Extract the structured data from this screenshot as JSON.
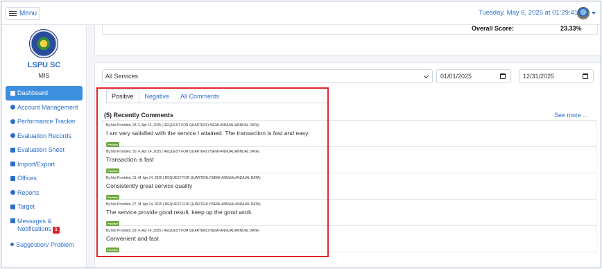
{
  "topbar": {
    "menu_label": "Menu",
    "datetime": "Tuesday, May 6, 2025 at 01:29:41 PM"
  },
  "sidebar": {
    "org_name": "LSPU SC",
    "org_sub": "MIS",
    "items": [
      {
        "label": "Dashboard",
        "icon": "dashboard-icon",
        "active": true
      },
      {
        "label": "Account Management",
        "icon": "users-icon"
      },
      {
        "label": "Performance Tracker",
        "icon": "gauge-icon"
      },
      {
        "label": "Evaluation Records",
        "icon": "gauge-icon"
      },
      {
        "label": "Evaluation Sheet",
        "icon": "document-icon"
      },
      {
        "label": "Import/Export",
        "icon": "file-icon"
      },
      {
        "label": "Offices",
        "icon": "building-icon"
      },
      {
        "label": "Reports",
        "icon": "gauge-icon"
      },
      {
        "label": "Target",
        "icon": "target-icon"
      },
      {
        "label": "Messages & Notifications",
        "icon": "envelope-icon",
        "badge": "1"
      },
      {
        "label": "Suggestion/ Problem",
        "icon": "lightbulb-icon"
      }
    ],
    "messages_line1": "Messages &",
    "messages_line2": "Notifications",
    "messages_badge": "1"
  },
  "score": {
    "label": "Overall Score:",
    "value": "23.33%"
  },
  "filters": {
    "service": "All Services",
    "date_from": "01/01/2025",
    "date_to": "12/31/2025"
  },
  "tabs": [
    {
      "label": "Positive",
      "active": true
    },
    {
      "label": "Negative"
    },
    {
      "label": "All Comments"
    }
  ],
  "comments": {
    "title": "(5) Recently Comments",
    "see_more": "See more ...",
    "items": [
      {
        "meta": "By:Not Provided, 28, F, Apr 14, 2025 | REQUEST FOR QUARTERLY/SEMI-ANNUAL/ANNUAL DATA)",
        "text": "I am very satisfied with the service I attained. The transaction is fast and easy.",
        "badge": "Positive"
      },
      {
        "meta": "By:Not Provided, 50, F, Apr 14, 2025 | REQUEST FOR QUARTERLY/SEMI-ANNUAL/ANNUAL DATA)",
        "text": "Transaction is fast",
        "badge": "Positive"
      },
      {
        "meta": "By:Not Provided, 31, M, Apr 14, 2025 | REQUEST FOR QUARTERLY/SEMI-ANNUAL/ANNUAL DATA)",
        "text": "Consistently great service quality",
        "badge": "Positive"
      },
      {
        "meta": "By:Not Provided, 27, M, Apr 14, 2025 | REQUEST FOR QUARTERLY/SEMI-ANNUAL/ANNUAL DATA)",
        "text": "The service provide good result, keep up the good work.",
        "badge": "Positive"
      },
      {
        "meta": "By:Not Provided, 29, F, Apr 14, 2025 | REQUEST FOR QUARTERLY/SEMI-ANNUAL/ANNUAL DATA)",
        "text": "Convenient and fast",
        "badge": "Positive"
      }
    ]
  },
  "colors": {
    "accent": "#2b6fc7",
    "active_nav": "#3d8fe0",
    "positive_badge": "#6aa53a",
    "highlight_box": "#e0262b"
  }
}
